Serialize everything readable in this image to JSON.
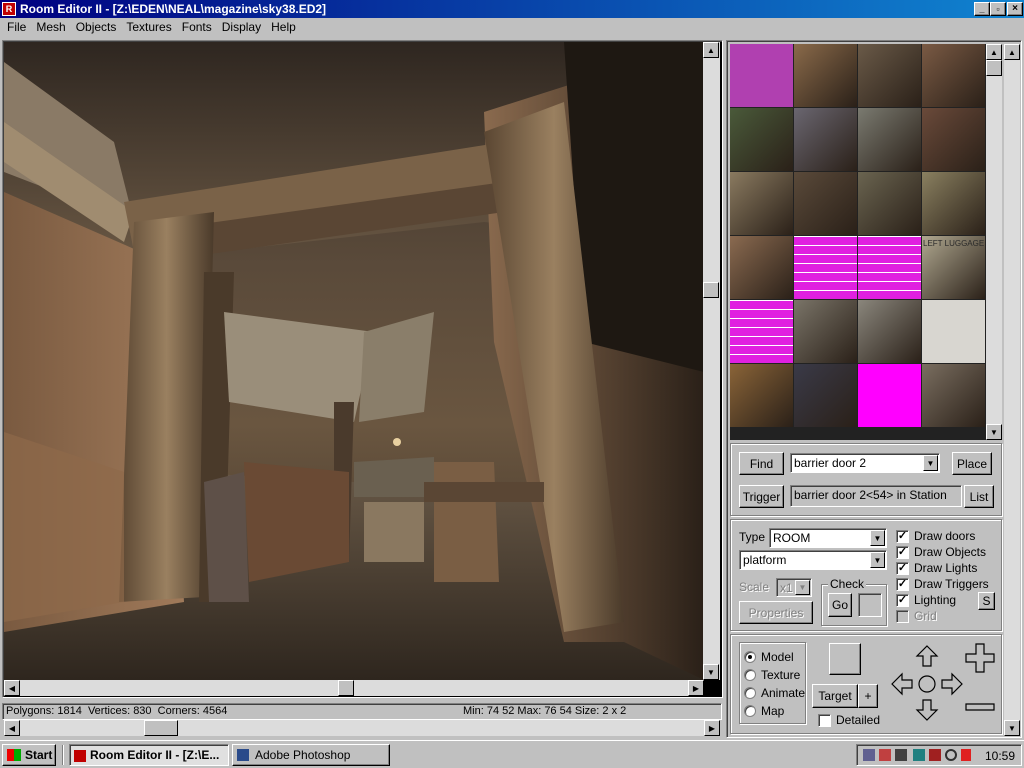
{
  "window": {
    "title": "Room Editor II - [Z:\\EDEN\\NEAL\\magazine\\sky38.ED2]"
  },
  "menu": [
    "File",
    "Mesh",
    "Objects",
    "Textures",
    "Fonts",
    "Display",
    "Help"
  ],
  "colors": {
    "title_start": "#000080",
    "title_end": "#1084d0",
    "face": "#c0c0c0",
    "magenta": "#ff00ff"
  },
  "textures": [
    {
      "name": "purple",
      "color": "#b040b0"
    },
    {
      "name": "bars",
      "color": "#8a6a4a"
    },
    {
      "name": "arch-window",
      "color": "#6a5a48"
    },
    {
      "name": "brick-wall",
      "color": "#7a5a44"
    },
    {
      "name": "green-panel",
      "color": "#4a5a3a"
    },
    {
      "name": "metal-box",
      "color": "#6a6670"
    },
    {
      "name": "vent",
      "color": "#7a7a70"
    },
    {
      "name": "dark-brick",
      "color": "#6a4a3a"
    },
    {
      "name": "timetable",
      "color": "#8a7a60"
    },
    {
      "name": "door-frame",
      "color": "#5a4a3a"
    },
    {
      "name": "glass-doors",
      "color": "#6a6450"
    },
    {
      "name": "timetable-2",
      "color": "#8a8060"
    },
    {
      "name": "stone",
      "color": "#8a6a50"
    },
    {
      "name": "magenta-warning",
      "color": "#e020e0"
    },
    {
      "name": "magenta-bricks",
      "color": "#e020e0"
    },
    {
      "name": "left-luggage",
      "color": "#b0a890"
    },
    {
      "name": "magenta-stripes",
      "color": "#e020e0"
    },
    {
      "name": "grey-wall",
      "color": "#7a7468"
    },
    {
      "name": "lockers",
      "color": "#8a867c"
    },
    {
      "name": "white-panel",
      "color": "#d8d6d0"
    },
    {
      "name": "rust-floor",
      "color": "#8a6438"
    },
    {
      "name": "hazard-door",
      "color": "#3a3a48"
    },
    {
      "name": "magenta-block",
      "color": "#ff00ff"
    },
    {
      "name": "grate",
      "color": "#7a6e60"
    }
  ],
  "texture_labels": {
    "left_luggage": "LEFT LUGGAGE"
  },
  "find": {
    "button": "Find",
    "value": "barrier door 2",
    "place": "Place"
  },
  "trigger": {
    "button": "Trigger",
    "value": "barrier door 2<54> in Station",
    "list": "List"
  },
  "type": {
    "label": "Type",
    "value": "ROOM",
    "sub_value": "platform"
  },
  "scale": {
    "label": "Scale",
    "value": "x1"
  },
  "check": {
    "label": "Check",
    "go": "Go"
  },
  "properties": "Properties",
  "draw": {
    "doors": {
      "label": "Draw doors",
      "checked": true
    },
    "objects": {
      "label": "Draw Objects",
      "checked": true
    },
    "lights": {
      "label": "Draw Lights",
      "checked": true
    },
    "triggers": {
      "label": "Draw Triggers",
      "checked": true
    },
    "lighting": {
      "label": "Lighting",
      "checked": true
    },
    "grid": {
      "label": "Grid",
      "checked": false
    },
    "s_button": "S"
  },
  "mode": {
    "model": "Model",
    "texture": "Texture",
    "animate": "Animate",
    "map": "Map",
    "selected": "model"
  },
  "target": {
    "button": "Target",
    "plus": "+",
    "detailed": "Detailed"
  },
  "status": {
    "polygons": "Polygons: 1814  Vertices: 830  Corners: 4564",
    "range": "Min: 74 52  Max: 76 54  Size: 2 x 2"
  },
  "taskbar": {
    "start": "Start",
    "tasks": [
      "Room Editor II - [Z:\\E...",
      "Adobe Photoshop"
    ],
    "clock": "10:59"
  }
}
